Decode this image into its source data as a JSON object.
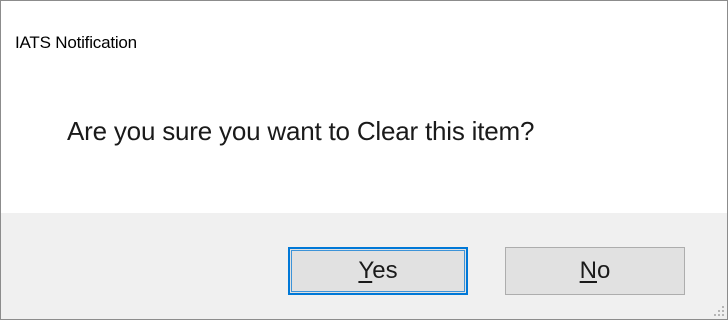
{
  "window": {
    "title": "IATS Notification"
  },
  "dialog": {
    "message": "Are you sure you want to Clear this item?"
  },
  "buttons": {
    "yes": {
      "mnemonic": "Y",
      "rest": "es"
    },
    "no": {
      "mnemonic": "N",
      "rest": "o"
    }
  },
  "colors": {
    "background": "#ffffff",
    "button_bar": "#f0f0f0",
    "button_face": "#e1e1e1",
    "focus_border": "#0078d7"
  }
}
